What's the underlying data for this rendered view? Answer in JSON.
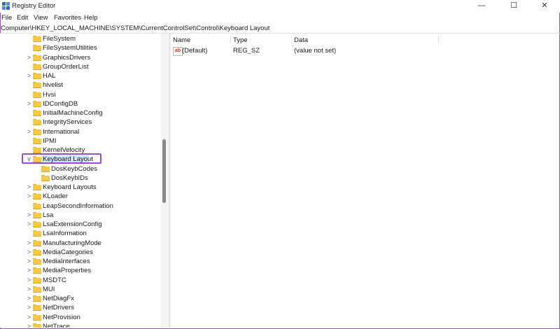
{
  "window": {
    "title": "Registry Editor",
    "icon": "registry-editor-icon"
  },
  "window_controls": {
    "minimize": "—",
    "maximize": "☐",
    "close": "✕"
  },
  "menu": [
    "File",
    "Edit",
    "View",
    "Favorites",
    "Help"
  ],
  "address": "Computer\\HKEY_LOCAL_MACHINE\\SYSTEM\\CurrentControlSet\\Control\\Keyboard Layout",
  "tree": {
    "items": [
      {
        "label": "FileSystem",
        "chevron": ""
      },
      {
        "label": "FileSystemUtilities",
        "chevron": ""
      },
      {
        "label": "GraphicsDrivers",
        "chevron": ">"
      },
      {
        "label": "GroupOrderList",
        "chevron": ""
      },
      {
        "label": "HAL",
        "chevron": ">"
      },
      {
        "label": "hivelist",
        "chevron": ""
      },
      {
        "label": "Hvsi",
        "chevron": ""
      },
      {
        "label": "IDConfigDB",
        "chevron": ">"
      },
      {
        "label": "InitialMachineConfig",
        "chevron": ""
      },
      {
        "label": "IntegrityServices",
        "chevron": ""
      },
      {
        "label": "International",
        "chevron": ">"
      },
      {
        "label": "IPMI",
        "chevron": ""
      },
      {
        "label": "KernelVelocity",
        "chevron": ""
      },
      {
        "label": "Keyboard Layout",
        "chevron": "v",
        "selected": true
      },
      {
        "label": "DosKeybCodes",
        "chevron": "",
        "child": true
      },
      {
        "label": "DosKeybIDs",
        "chevron": "",
        "child": true
      },
      {
        "label": "Keyboard Layouts",
        "chevron": ">"
      },
      {
        "label": "KLoader",
        "chevron": ">"
      },
      {
        "label": "LeapSecondInformation",
        "chevron": ""
      },
      {
        "label": "Lsa",
        "chevron": ">"
      },
      {
        "label": "LsaExtensionConfig",
        "chevron": ">"
      },
      {
        "label": "LsaInformation",
        "chevron": ""
      },
      {
        "label": "ManufacturingMode",
        "chevron": ">"
      },
      {
        "label": "MediaCategories",
        "chevron": ">"
      },
      {
        "label": "MediaInterfaces",
        "chevron": ">"
      },
      {
        "label": "MediaProperties",
        "chevron": ">"
      },
      {
        "label": "MSDTC",
        "chevron": ">"
      },
      {
        "label": "MUI",
        "chevron": ">"
      },
      {
        "label": "NetDiagFx",
        "chevron": ">"
      },
      {
        "label": "NetDrivers",
        "chevron": ">"
      },
      {
        "label": "NetProvision",
        "chevron": ">"
      },
      {
        "label": "NetTrace",
        "chevron": ">"
      }
    ]
  },
  "values": {
    "columns": [
      "Name",
      "Type",
      "Data"
    ],
    "rows": [
      {
        "icon": "ab",
        "name": "(Default)",
        "type": "REG_SZ",
        "data": "(value not set)"
      }
    ]
  },
  "colors": {
    "highlight_border": "#9b4fc1",
    "selection": "#cde6f7",
    "folder": "#f3c94c"
  }
}
